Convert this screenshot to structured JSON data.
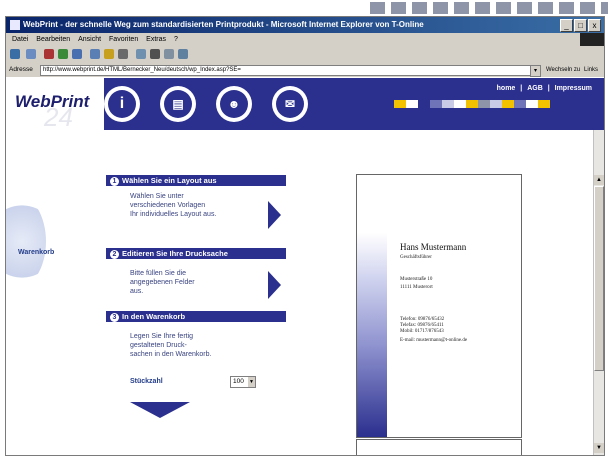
{
  "window": {
    "title": "WebPrint - der schnelle Weg zum standardisierten Printprodukt - Microsoft Internet Explorer von T-Online",
    "controls": [
      "_",
      "□",
      "x"
    ]
  },
  "menu": [
    "Datei",
    "Bearbeiten",
    "Ansicht",
    "Favoriten",
    "Extras",
    "?"
  ],
  "address": {
    "label": "Adresse",
    "url": "http://www.webprint.de/HTML/Bernecker_Neu/deutsch/wp_Index.asp?SE=",
    "go_label": "Wechseln zu",
    "links_label": "Links"
  },
  "site": {
    "logo": "WebPrint",
    "logo_sub": "24",
    "toplinks": [
      "home",
      "|",
      "AGB",
      "|",
      "Impressum"
    ],
    "nav_icons": [
      "info-icon",
      "paper-stack-icon",
      "people-icon",
      "mail-icon"
    ],
    "colors": {
      "brand_blue": "#2b2f8e",
      "block_colors": [
        "#f2c200",
        "#ffffff",
        "#2b2f8e",
        "#6f74b8",
        "#c8cae6",
        "#ffffff",
        "#f2c200",
        "#8f95a8"
      ]
    }
  },
  "sidebar": {
    "warenkorb": "Warenkorb"
  },
  "steps": [
    {
      "num": "1",
      "title": "Wählen Sie ein Layout aus",
      "text": [
        "Wählen Sie unter",
        "verschiedenen Vorlagen",
        "Ihr individuelles Layout aus."
      ]
    },
    {
      "num": "2",
      "title": "Editieren Sie Ihre Drucksache",
      "text": [
        "Bitte füllen Sie die",
        "angegebenen Felder",
        "aus."
      ]
    },
    {
      "num": "3",
      "title": "In den Warenkorb",
      "text": [
        "Legen Sie Ihre fertig",
        "gestalteten Druck-",
        "sachen in den Warenkorb."
      ]
    }
  ],
  "quantity": {
    "label": "Stückzahl",
    "value": "100"
  },
  "card": {
    "name": "Hans Mustermann",
    "role": "Geschäftsführer",
    "street": "Musterstraße 10",
    "city": "11111 Musterort",
    "phone1": "Telefon: 09876/65432",
    "phone2": "Telefax: 09876/65411",
    "mobile": "Mobil: 01717/876543",
    "email": "E-mail: mustermann@t-online.de"
  },
  "scroll": {
    "up": "▲",
    "down": "▼"
  }
}
